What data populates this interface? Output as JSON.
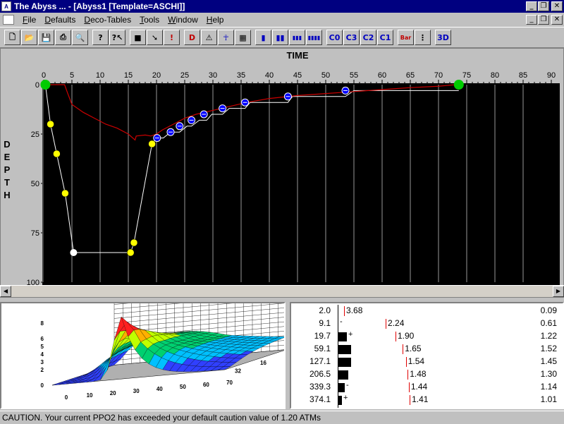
{
  "window": {
    "title": "The Abyss ...   - [Abyss1 [Template=ASCHI]]",
    "app_icon_text": "A"
  },
  "menu": [
    "File",
    "Defaults",
    "Deco-Tables",
    "Tools",
    "Window",
    "Help"
  ],
  "toolbar": {
    "buttons": [
      {
        "name": "new-icon",
        "glyph": "🗋"
      },
      {
        "name": "open-icon",
        "glyph": "📂"
      },
      {
        "name": "save-icon",
        "glyph": "💾"
      },
      {
        "name": "print-icon",
        "glyph": "⎙"
      },
      {
        "name": "preview-icon",
        "glyph": "🔍"
      },
      {
        "name": "help-icon",
        "glyph": "?"
      },
      {
        "name": "context-help-icon",
        "glyph": "?↖"
      },
      {
        "name": "gray-square-icon",
        "glyph": "■"
      },
      {
        "name": "pointer-icon",
        "glyph": "➘"
      },
      {
        "name": "exclamation-icon",
        "glyph": "!"
      },
      {
        "name": "deco-icon",
        "glyph": "D"
      },
      {
        "name": "warning-icon",
        "glyph": "⚠"
      },
      {
        "name": "diver-icon",
        "glyph": "☥"
      },
      {
        "name": "rainbow-icon",
        "glyph": "▦"
      },
      {
        "name": "bars1-icon",
        "glyph": "▮"
      },
      {
        "name": "bars2-icon",
        "glyph": "▮▮"
      },
      {
        "name": "bars3-icon",
        "glyph": "▮▮▮"
      },
      {
        "name": "bars4-icon",
        "glyph": "▮▮▮▮"
      },
      {
        "name": "c0-icon",
        "glyph": "C0"
      },
      {
        "name": "c3-icon",
        "glyph": "C3"
      },
      {
        "name": "c2-icon",
        "glyph": "C2"
      },
      {
        "name": "c1-icon",
        "glyph": "C1"
      },
      {
        "name": "bar-icon",
        "glyph": "Bar"
      },
      {
        "name": "grid-icon",
        "glyph": "⋮"
      },
      {
        "name": "3d-icon",
        "glyph": "3D"
      }
    ]
  },
  "graph": {
    "x_title": "TIME",
    "y_title": [
      "D",
      "E",
      "P",
      "T",
      "H"
    ],
    "background": "#000000",
    "profile_color": "#ffffff",
    "ceiling_color": "#cc0000",
    "descent_marker_color": "#ffff00",
    "stop_marker_color": "#0000ff",
    "surface_marker_color": "#00cc00"
  },
  "chart_data": {
    "type": "line",
    "xlabel": "TIME",
    "ylabel": "DEPTH",
    "xlim": [
      0,
      90
    ],
    "ylim": [
      0,
      100
    ],
    "x_ticks": [
      0,
      5,
      10,
      15,
      20,
      25,
      30,
      35,
      40,
      45,
      50,
      55,
      60,
      65,
      70,
      75,
      80,
      85,
      90
    ],
    "y_ticks": [
      0,
      25,
      50,
      75,
      100
    ],
    "y_inverted": true,
    "grid": true,
    "series": [
      {
        "kind": "profile",
        "x": [
          0.3,
          1.2,
          2.3,
          3.8,
          5.3,
          15.4,
          16,
          19.2,
          20.1,
          21.2,
          22.5,
          24.1,
          25.4,
          26.2,
          27.6,
          28.9,
          29.8,
          31.7,
          32.9,
          35.7,
          36.6,
          43.3,
          44.1,
          53.5,
          55,
          73.6
        ],
        "y": [
          0,
          20,
          35,
          55,
          85,
          85,
          80,
          30,
          27,
          27,
          24,
          24,
          21,
          21,
          18,
          18,
          15,
          15,
          12,
          12,
          9,
          9,
          6,
          6,
          3,
          3
        ]
      },
      {
        "kind": "ceiling",
        "x": [
          0,
          1,
          3,
          3.7,
          4.2,
          5,
          7,
          9,
          11,
          13,
          15,
          16.2,
          16.4,
          18,
          19,
          20,
          21,
          23,
          25,
          27,
          30,
          33,
          36,
          40,
          45,
          50,
          55,
          60,
          65,
          70,
          73
        ],
        "y": [
          0,
          0,
          0,
          0,
          4,
          10,
          14,
          17,
          20,
          22,
          25,
          28,
          26,
          25.5,
          26,
          25,
          23,
          20,
          17,
          15,
          13,
          11,
          9,
          7,
          5.5,
          4.5,
          3.5,
          2.5,
          1.5,
          0.8,
          0
        ]
      }
    ],
    "markers": [
      {
        "kind": "surface",
        "x": 0.3,
        "y": 0
      },
      {
        "kind": "descent",
        "x": 1.2,
        "y": 20
      },
      {
        "kind": "descent",
        "x": 2.3,
        "y": 35
      },
      {
        "kind": "descent",
        "x": 3.8,
        "y": 55
      },
      {
        "kind": "bottom",
        "x": 5.3,
        "y": 85
      },
      {
        "kind": "descent",
        "x": 15.4,
        "y": 85
      },
      {
        "kind": "descent",
        "x": 16,
        "y": 80
      },
      {
        "kind": "descent",
        "x": 19.2,
        "y": 30
      },
      {
        "kind": "stop",
        "x": 20.1,
        "y": 27
      },
      {
        "kind": "stop",
        "x": 22.5,
        "y": 24
      },
      {
        "kind": "stop",
        "x": 24.1,
        "y": 21
      },
      {
        "kind": "stop",
        "x": 26.2,
        "y": 18
      },
      {
        "kind": "stop",
        "x": 28.4,
        "y": 15
      },
      {
        "kind": "stop",
        "x": 31.7,
        "y": 12
      },
      {
        "kind": "stop",
        "x": 35.7,
        "y": 9
      },
      {
        "kind": "stop",
        "x": 43.3,
        "y": 6
      },
      {
        "kind": "stop",
        "x": 53.5,
        "y": 3
      },
      {
        "kind": "surface",
        "x": 73.6,
        "y": 0
      }
    ]
  },
  "surface3d": {
    "z_ticks": [
      "8",
      "6",
      "5",
      "4",
      "3",
      "2",
      "0"
    ],
    "x_ticks": [
      "0",
      "10",
      "20",
      "30",
      "40",
      "50",
      "60",
      "70"
    ],
    "y_ticks": [
      "16",
      "32"
    ]
  },
  "tissues": [
    {
      "pressure": "2.0",
      "mvalue": "3.68",
      "ratio": "0.09",
      "bar": 0,
      "sign": ""
    },
    {
      "pressure": "9.1",
      "mvalue": "2.24",
      "ratio": "0.61",
      "bar": 0,
      "sign": "-"
    },
    {
      "pressure": "19.7",
      "mvalue": "1.90",
      "ratio": "1.22",
      "bar": 12,
      "sign": "+"
    },
    {
      "pressure": "59.1",
      "mvalue": "1.65",
      "ratio": "1.52",
      "bar": 18,
      "sign": ""
    },
    {
      "pressure": "127.1",
      "mvalue": "1.54",
      "ratio": "1.45",
      "bar": 18,
      "sign": ""
    },
    {
      "pressure": "206.5",
      "mvalue": "1.48",
      "ratio": "1.30",
      "bar": 14,
      "sign": ""
    },
    {
      "pressure": "339.3",
      "mvalue": "1.44",
      "ratio": "1.14",
      "bar": 9,
      "sign": "-"
    },
    {
      "pressure": "374.1",
      "mvalue": "1.41",
      "ratio": "1.01",
      "bar": 5,
      "sign": "+"
    }
  ],
  "status": {
    "text": "CAUTION. Your current PPO2 has exceeded your default caution value of 1.20 ATMs"
  }
}
